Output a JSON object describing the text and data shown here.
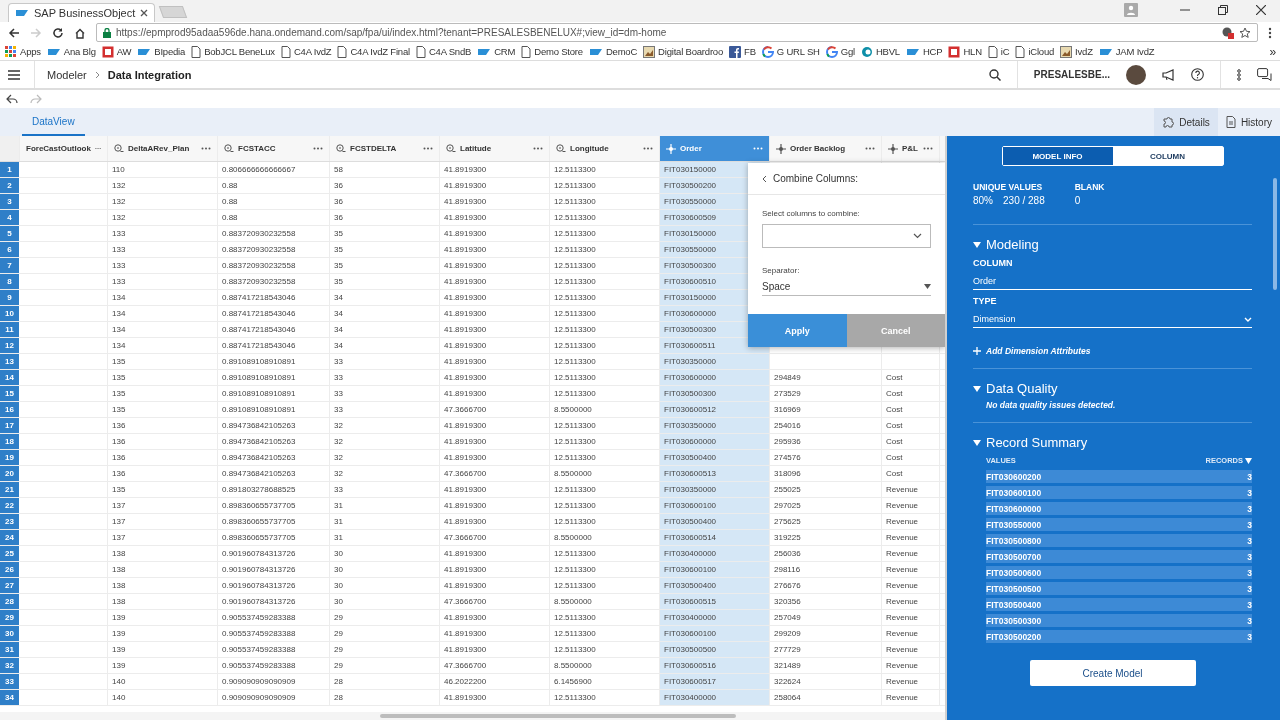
{
  "browser": {
    "tab_title": "SAP BusinessObject",
    "url": "https://epmprod95adaa596de.hana.ondemand.com/sap/fpa/ui/index.html?tenant=PRESALESBENELUX#;view_id=dm-home",
    "bookmarks": [
      {
        "label": "Apps",
        "kind": "apps"
      },
      {
        "label": "Ana Blg",
        "kind": "sap"
      },
      {
        "label": "AW",
        "kind": "square"
      },
      {
        "label": "BIpedia",
        "kind": "sap"
      },
      {
        "label": "BobJCL BeneLux",
        "kind": "page"
      },
      {
        "label": "C4A IvdZ",
        "kind": "page"
      },
      {
        "label": "C4A IvdZ Final",
        "kind": "page"
      },
      {
        "label": "C4A SndB",
        "kind": "page"
      },
      {
        "label": "CRM",
        "kind": "sap"
      },
      {
        "label": "Demo Store",
        "kind": "page"
      },
      {
        "label": "DemoC",
        "kind": "sap"
      },
      {
        "label": "Digital Boardroo",
        "kind": "image"
      },
      {
        "label": "FB",
        "kind": "facebook"
      },
      {
        "label": "G URL SH",
        "kind": "google"
      },
      {
        "label": "Ggl",
        "kind": "google"
      },
      {
        "label": "HBVL",
        "kind": "ring"
      },
      {
        "label": "HCP",
        "kind": "sap"
      },
      {
        "label": "HLN",
        "kind": "square"
      },
      {
        "label": "iC",
        "kind": "page"
      },
      {
        "label": "iCloud",
        "kind": "page"
      },
      {
        "label": "IvdZ",
        "kind": "image"
      },
      {
        "label": "JAM IvdZ",
        "kind": "sap"
      }
    ],
    "more": "»"
  },
  "shell": {
    "breadcrumb": [
      "Modeler",
      "Data Integration"
    ],
    "tenant": "PRESALESBE..."
  },
  "tabs": [
    {
      "label": "DataView",
      "selected": true
    }
  ],
  "side_tabs": [
    {
      "label": "Details",
      "selected": true,
      "kind": "puzzle"
    },
    {
      "label": "History",
      "selected": false,
      "kind": "document"
    }
  ],
  "table": {
    "columns": [
      {
        "label": "ForeCastOutlook",
        "kind": "plain",
        "selected": false
      },
      {
        "label": "DeltaARev_Plan",
        "kind": "measure",
        "selected": false
      },
      {
        "label": "FCSTACC",
        "kind": "measure",
        "selected": false
      },
      {
        "label": "FCSTDELTA",
        "kind": "measure",
        "selected": false
      },
      {
        "label": "Latitude",
        "kind": "measure",
        "selected": false
      },
      {
        "label": "Longitude",
        "kind": "measure",
        "selected": false
      },
      {
        "label": "Order",
        "kind": "dimension",
        "selected": true
      },
      {
        "label": "Order Backlog",
        "kind": "dimension",
        "selected": false
      },
      {
        "label": "P&L",
        "kind": "dimension",
        "selected": false
      }
    ],
    "rows": [
      {
        "number": "1",
        "cells": [
          "",
          "110",
          "0.806666666666667",
          "58",
          "41.8919300",
          "12.5113300",
          "FIT030150000"
        ]
      },
      {
        "number": "2",
        "cells": [
          "",
          "132",
          "0.88",
          "36",
          "41.8919300",
          "12.5113300",
          "FIT030500200"
        ]
      },
      {
        "number": "3",
        "cells": [
          "",
          "132",
          "0.88",
          "36",
          "41.8919300",
          "12.5113300",
          "FIT030550000"
        ]
      },
      {
        "number": "4",
        "cells": [
          "",
          "132",
          "0.88",
          "36",
          "41.8919300",
          "12.5113300",
          "FIT030600509"
        ]
      },
      {
        "number": "5",
        "cells": [
          "",
          "133",
          "0.883720930232558",
          "35",
          "41.8919300",
          "12.5113300",
          "FIT030150000"
        ]
      },
      {
        "number": "6",
        "cells": [
          "",
          "133",
          "0.883720930232558",
          "35",
          "41.8919300",
          "12.5113300",
          "FIT030550000"
        ]
      },
      {
        "number": "7",
        "cells": [
          "",
          "133",
          "0.883720930232558",
          "35",
          "41.8919300",
          "12.5113300",
          "FIT030500300"
        ]
      },
      {
        "number": "8",
        "cells": [
          "",
          "133",
          "0.883720930232558",
          "35",
          "41.8919300",
          "12.5113300",
          "FIT030600510"
        ]
      },
      {
        "number": "9",
        "cells": [
          "",
          "134",
          "0.887417218543046",
          "34",
          "41.8919300",
          "12.5113300",
          "FIT030150000"
        ]
      },
      {
        "number": "10",
        "cells": [
          "",
          "134",
          "0.887417218543046",
          "34",
          "41.8919300",
          "12.5113300",
          "FIT030600000"
        ]
      },
      {
        "number": "11",
        "cells": [
          "",
          "134",
          "0.887417218543046",
          "34",
          "41.8919300",
          "12.5113300",
          "FIT030500300"
        ]
      },
      {
        "number": "12",
        "cells": [
          "",
          "134",
          "0.887417218543046",
          "34",
          "41.8919300",
          "12.5113300",
          "FIT030600511"
        ]
      },
      {
        "number": "13",
        "cells": [
          "",
          "135",
          "0.891089108910891",
          "33",
          "41.8919300",
          "12.5113300",
          "FIT030350000"
        ]
      },
      {
        "number": "14",
        "cells": [
          "",
          "135",
          "0.891089108910891",
          "33",
          "41.8919300",
          "12.5113300",
          "FIT030600000",
          "294849",
          "Cost"
        ]
      },
      {
        "number": "15",
        "cells": [
          "",
          "135",
          "0.891089108910891",
          "33",
          "41.8919300",
          "12.5113300",
          "FIT030500300",
          "273529",
          "Cost"
        ]
      },
      {
        "number": "16",
        "cells": [
          "",
          "135",
          "0.891089108910891",
          "33",
          "47.3666700",
          "8.5500000",
          "FIT030600512",
          "316969",
          "Cost"
        ]
      },
      {
        "number": "17",
        "cells": [
          "",
          "136",
          "0.894736842105263",
          "32",
          "41.8919300",
          "12.5113300",
          "FIT030350000",
          "254016",
          "Cost"
        ]
      },
      {
        "number": "18",
        "cells": [
          "",
          "136",
          "0.894736842105263",
          "32",
          "41.8919300",
          "12.5113300",
          "FIT030600000",
          "295936",
          "Cost"
        ]
      },
      {
        "number": "19",
        "cells": [
          "",
          "136",
          "0.894736842105263",
          "32",
          "41.8919300",
          "12.5113300",
          "FIT030500400",
          "274576",
          "Cost"
        ]
      },
      {
        "number": "20",
        "cells": [
          "",
          "136",
          "0.894736842105263",
          "32",
          "47.3666700",
          "8.5500000",
          "FIT030600513",
          "318096",
          "Cost"
        ]
      },
      {
        "number": "21",
        "cells": [
          "",
          "135",
          "0.891803278688525",
          "33",
          "41.8919300",
          "12.5113300",
          "FIT030350000",
          "255025",
          "Revenue"
        ]
      },
      {
        "number": "22",
        "cells": [
          "",
          "137",
          "0.898360655737705",
          "31",
          "41.8919300",
          "12.5113300",
          "FIT030600100",
          "297025",
          "Revenue"
        ]
      },
      {
        "number": "23",
        "cells": [
          "",
          "137",
          "0.898360655737705",
          "31",
          "41.8919300",
          "12.5113300",
          "FIT030500400",
          "275625",
          "Revenue"
        ]
      },
      {
        "number": "24",
        "cells": [
          "",
          "137",
          "0.898360655737705",
          "31",
          "47.3666700",
          "8.5500000",
          "FIT030600514",
          "319225",
          "Revenue"
        ]
      },
      {
        "number": "25",
        "cells": [
          "",
          "138",
          "0.901960784313726",
          "30",
          "41.8919300",
          "12.5113300",
          "FIT030400000",
          "256036",
          "Revenue"
        ]
      },
      {
        "number": "26",
        "cells": [
          "",
          "138",
          "0.901960784313726",
          "30",
          "41.8919300",
          "12.5113300",
          "FIT030600100",
          "298116",
          "Revenue"
        ]
      },
      {
        "number": "27",
        "cells": [
          "",
          "138",
          "0.901960784313726",
          "30",
          "41.8919300",
          "12.5113300",
          "FIT030500400",
          "276676",
          "Revenue"
        ]
      },
      {
        "number": "28",
        "cells": [
          "",
          "138",
          "0.901960784313726",
          "30",
          "47.3666700",
          "8.5500000",
          "FIT030600515",
          "320356",
          "Revenue"
        ]
      },
      {
        "number": "29",
        "cells": [
          "",
          "139",
          "0.905537459283388",
          "29",
          "41.8919300",
          "12.5113300",
          "FIT030400000",
          "257049",
          "Revenue"
        ]
      },
      {
        "number": "30",
        "cells": [
          "",
          "139",
          "0.905537459283388",
          "29",
          "41.8919300",
          "12.5113300",
          "FIT030600100",
          "299209",
          "Revenue"
        ]
      },
      {
        "number": "31",
        "cells": [
          "",
          "139",
          "0.905537459283388",
          "29",
          "41.8919300",
          "12.5113300",
          "FIT030500500",
          "277729",
          "Revenue"
        ]
      },
      {
        "number": "32",
        "cells": [
          "",
          "139",
          "0.905537459283388",
          "29",
          "47.3666700",
          "8.5500000",
          "FIT030600516",
          "321489",
          "Revenue"
        ]
      },
      {
        "number": "33",
        "cells": [
          "",
          "140",
          "0.909090909090909",
          "28",
          "46.2022200",
          "6.1456900",
          "FIT030600517",
          "322624",
          "Revenue"
        ]
      },
      {
        "number": "34",
        "cells": [
          "",
          "140",
          "0.909090909090909",
          "28",
          "41.8919300",
          "12.5113300",
          "FIT030400000",
          "258064",
          "Revenue"
        ]
      }
    ]
  },
  "popover": {
    "title": "Combine Columns:",
    "select_label": "Select columns to combine:",
    "separator_label": "Separator:",
    "separator_value": "Space",
    "buttons": [
      {
        "label": "Apply",
        "kind": "primary"
      },
      {
        "label": "Cancel",
        "kind": "secondary"
      }
    ]
  },
  "panel": {
    "segments": [
      {
        "label": "MODEL INFO",
        "selected": true
      },
      {
        "label": "COLUMN",
        "selected": false
      }
    ],
    "stats": [
      {
        "label": "UNIQUE VALUES",
        "values": [
          "80%",
          "230 / 288"
        ]
      },
      {
        "label": "BLANK",
        "values": [
          "0"
        ]
      }
    ],
    "modeling": {
      "title": "Modeling",
      "expanded": true,
      "column_label": "COLUMN",
      "column_value": "Order",
      "type_label": "TYPE",
      "type_value": "Dimension",
      "add_link": "Add Dimension Attributes"
    },
    "data_quality": {
      "title": "Data Quality",
      "expanded": true,
      "message": "No data quality issues detected."
    },
    "record_summary": {
      "title": "Record Summary",
      "expanded": true,
      "values_header": "VALUES",
      "records_header": "RECORDS",
      "items": [
        {
          "value": "FIT030600200",
          "records": "3"
        },
        {
          "value": "FIT030600100",
          "records": "3"
        },
        {
          "value": "FIT030600000",
          "records": "3"
        },
        {
          "value": "FIT030550000",
          "records": "3"
        },
        {
          "value": "FIT030500800",
          "records": "3"
        },
        {
          "value": "FIT030500700",
          "records": "3"
        },
        {
          "value": "FIT030500600",
          "records": "3"
        },
        {
          "value": "FIT030500500",
          "records": "3"
        },
        {
          "value": "FIT030500400",
          "records": "3"
        },
        {
          "value": "FIT030500300",
          "records": "3"
        },
        {
          "value": "FIT030500200",
          "records": "3"
        }
      ]
    },
    "create_button": "Create Model"
  }
}
